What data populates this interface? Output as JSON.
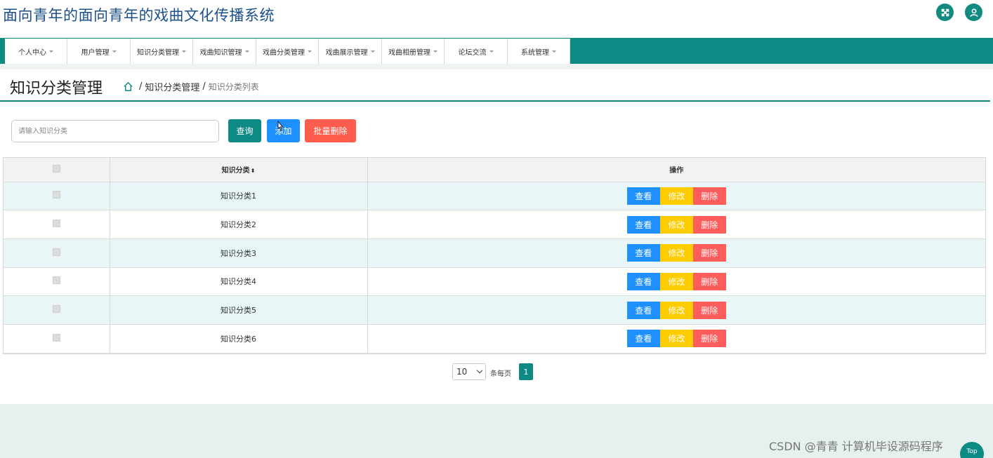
{
  "header": {
    "site_title": "面向青年的面向青年的戏曲文化传播系统",
    "icons": [
      "expand-icon",
      "user-icon"
    ]
  },
  "nav": {
    "items": [
      {
        "label": "个人中心",
        "width": 89
      },
      {
        "label": "用户管理",
        "width": 90
      },
      {
        "label": "知识分类管理",
        "width": 89
      },
      {
        "label": "戏曲知识管理",
        "width": 90
      },
      {
        "label": "戏曲分类管理",
        "width": 89
      },
      {
        "label": "戏曲展示管理",
        "width": 90
      },
      {
        "label": "戏曲相册管理",
        "width": 89
      },
      {
        "label": "论坛交流",
        "width": 90
      },
      {
        "label": "系统管理",
        "width": 89
      }
    ]
  },
  "titlebar": {
    "page_title": "知识分类管理",
    "breadcrumb": [
      "知识分类管理",
      "知识分类列表"
    ],
    "breadcrumb_sep": "/"
  },
  "search": {
    "placeholder": "请输入知识分类",
    "query_label": "查询",
    "add_label": "添加",
    "batch_delete_label": "批量删除"
  },
  "table": {
    "columns": [
      "",
      "知识分类",
      "操作"
    ],
    "sort_glyph": "⬍",
    "rows": [
      {
        "name": "知识分类1"
      },
      {
        "name": "知识分类2"
      },
      {
        "name": "知识分类3"
      },
      {
        "name": "知识分类4"
      },
      {
        "name": "知识分类5"
      },
      {
        "name": "知识分类6"
      }
    ],
    "ops": {
      "view": "查看",
      "edit": "修改",
      "delete": "删除"
    }
  },
  "pagination": {
    "page_size": "10",
    "per_page_label": "条每页",
    "current_page": "1"
  },
  "footer": {
    "watermark": "CSDN @青青  计算机毕设源码程序",
    "top_label": "Top"
  },
  "colors": {
    "primary": "#0e8a84",
    "blue": "#1e90ff",
    "yellow": "#ffcc00",
    "red": "#ff5c5c",
    "row_alt": "#e8f6f8"
  }
}
